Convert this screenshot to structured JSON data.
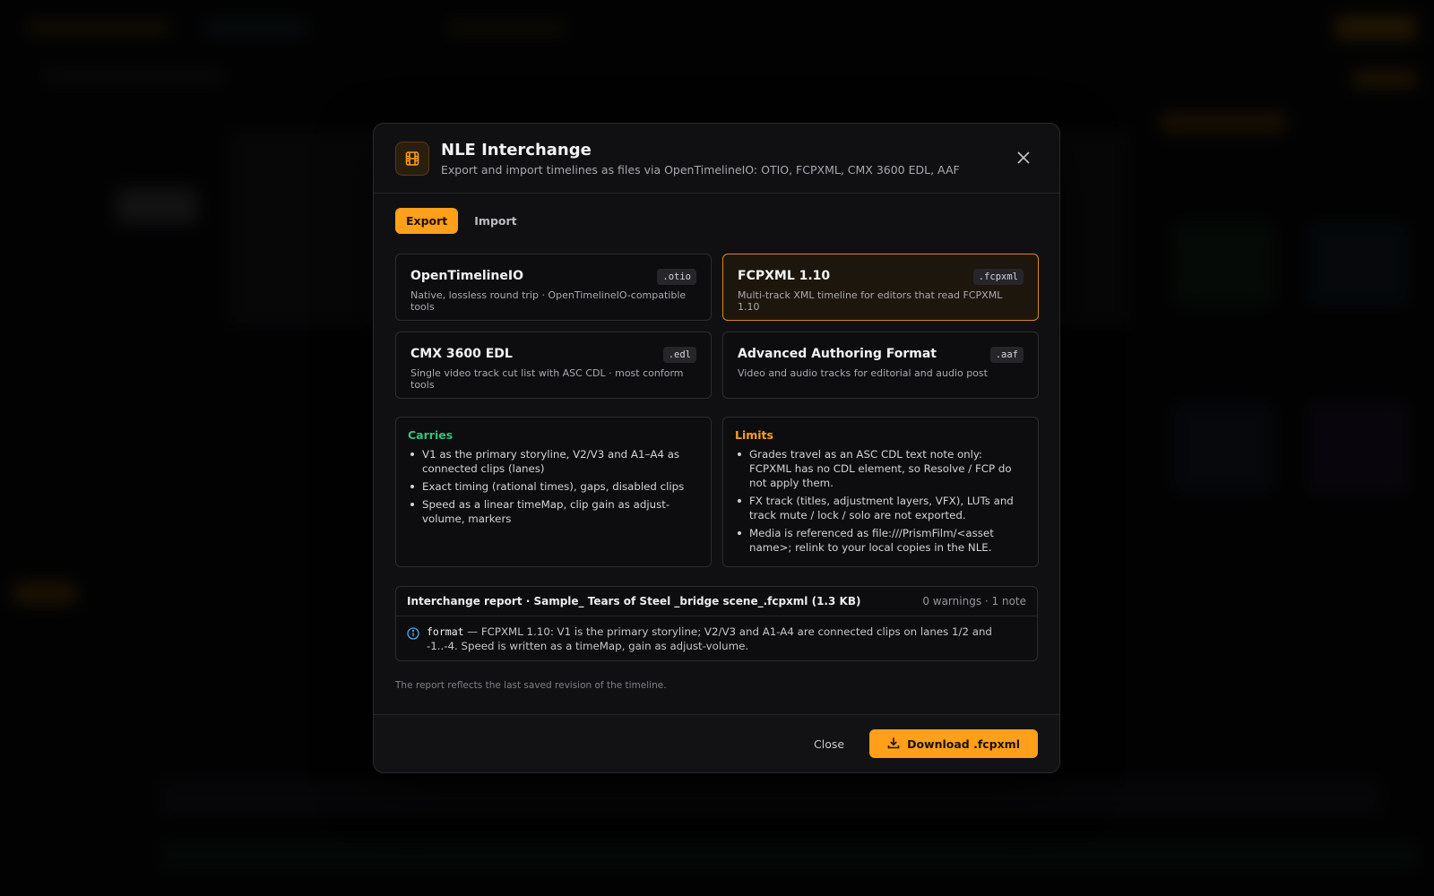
{
  "modal": {
    "title": "NLE Interchange",
    "subtitle": "Export and import timelines as files via OpenTimelineIO: OTIO, FCPXML, CMX 3600 EDL, AAF"
  },
  "tabs": [
    {
      "label": "Export",
      "active": true
    },
    {
      "label": "Import",
      "active": false
    }
  ],
  "formats": [
    {
      "name": "OpenTimelineIO",
      "ext": ".otio",
      "desc": "Native, lossless round trip · OpenTimelineIO-compatible tools",
      "selected": false
    },
    {
      "name": "FCPXML 1.10",
      "ext": ".fcpxml",
      "desc": "Multi-track XML timeline for editors that read FCPXML 1.10",
      "selected": true
    },
    {
      "name": "CMX 3600 EDL",
      "ext": ".edl",
      "desc": "Single video track cut list with ASC CDL · most conform tools",
      "selected": false
    },
    {
      "name": "Advanced Authoring Format",
      "ext": ".aaf",
      "desc": "Video and audio tracks for editorial and audio post",
      "selected": false
    }
  ],
  "carries": {
    "heading": "Carries",
    "items": [
      "V1 as the primary storyline, V2/V3 and A1–A4 as connected clips (lanes)",
      "Exact timing (rational times), gaps, disabled clips",
      "Speed as a linear timeMap, clip gain as adjust-volume, markers"
    ]
  },
  "limits": {
    "heading": "Limits",
    "items": [
      "Grades travel as an ASC CDL text note only: FCPXML has no CDL element, so Resolve / FCP do not apply them.",
      "FX track (titles, adjustment layers, VFX), LUTs and track mute / lock / solo are not exported.",
      "Media is referenced as file:///PrismFilm/<asset name>; relink to your local copies in the NLE."
    ]
  },
  "report": {
    "title": "Interchange report · Sample_ Tears of Steel _bridge scene_.fcpxml (1.3 KB)",
    "counts": "0 warnings · 1 note",
    "entry_key": "format",
    "entry_text": " — FCPXML 1.10: V1 is the primary storyline; V2/V3 and A1-A4 are connected clips on lanes 1/2 and -1..-4. Speed is written as a timeMap, gain as adjust-volume."
  },
  "footnote": "The report reflects the last saved revision of the timeline.",
  "footer": {
    "close_label": "Close",
    "download_label": "Download .fcpxml"
  },
  "colors": {
    "accent": "#ff9f1a",
    "carries": "#2fc47a",
    "info": "#4aa8e8"
  },
  "icons": {
    "header": "film-icon",
    "close": "close-icon",
    "info": "info-icon",
    "download": "download-icon"
  }
}
